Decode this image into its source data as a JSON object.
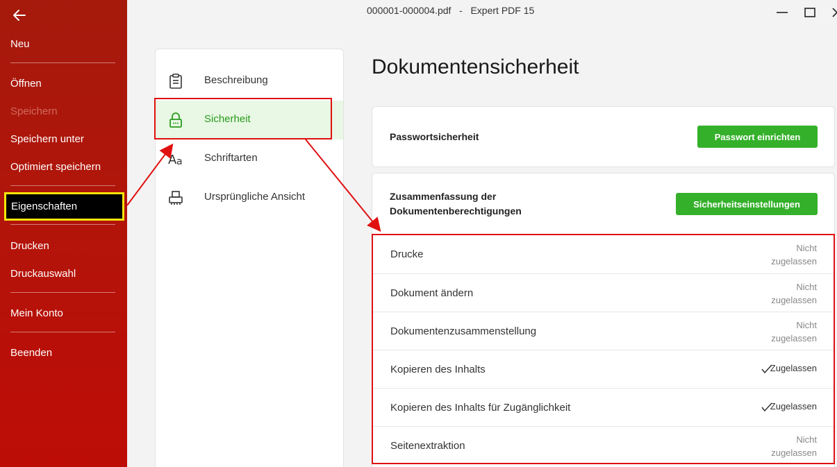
{
  "window": {
    "filename": "000001-000004.pdf",
    "separator": "-",
    "app": "Expert PDF 15"
  },
  "sidebar": {
    "items": [
      {
        "label": "Neu"
      },
      {
        "label": "Öffnen"
      },
      {
        "label": "Speichern",
        "disabled": true
      },
      {
        "label": "Speichern unter"
      },
      {
        "label": "Optimiert speichern"
      },
      {
        "label": "Eigenschaften",
        "active": true
      },
      {
        "label": "Drucken"
      },
      {
        "label": "Druckauswahl"
      },
      {
        "label": "Mein Konto"
      },
      {
        "label": "Beenden"
      }
    ]
  },
  "nav": {
    "items": [
      {
        "label": "Beschreibung",
        "icon": "clipboard-icon"
      },
      {
        "label": "Sicherheit",
        "icon": "lock-icon",
        "selected": true
      },
      {
        "label": "Schriftarten",
        "icon": "font-icon"
      },
      {
        "label": "Ursprüngliche Ansicht",
        "icon": "printer-icon"
      }
    ]
  },
  "main": {
    "title": "Dokumentensicherheit",
    "password_card": {
      "title": "Passwortsicherheit",
      "button": "Passwort einrichten"
    },
    "permissions_card": {
      "title_line1": "Zusammenfassung der",
      "title_line2": "Dokumentenberechtigungen",
      "button": "Sicherheitseinstellungen",
      "rows": [
        {
          "label": "Drucke",
          "status_line1": "Nicht",
          "status_line2": "zugelassen",
          "allowed": false
        },
        {
          "label": "Dokument ändern",
          "status_line1": "Nicht",
          "status_line2": "zugelassen",
          "allowed": false
        },
        {
          "label": "Dokumentenzusammenstellung",
          "status_line1": "Nicht",
          "status_line2": "zugelassen",
          "allowed": false
        },
        {
          "label": "Kopieren des Inhalts",
          "status": "Zugelassen",
          "allowed": true
        },
        {
          "label": "Kopieren des Inhalts für Zugänglichkeit",
          "status": "Zugelassen",
          "allowed": true
        },
        {
          "label": "Seitenextraktion",
          "status_line1": "Nicht",
          "status_line2": "zugelassen",
          "allowed": false
        }
      ]
    }
  },
  "colors": {
    "sidebar_red": "#b3140a",
    "accent_green": "#34b02a",
    "highlight_red": "#e01010",
    "highlight_yellow": "#f5e60a"
  }
}
